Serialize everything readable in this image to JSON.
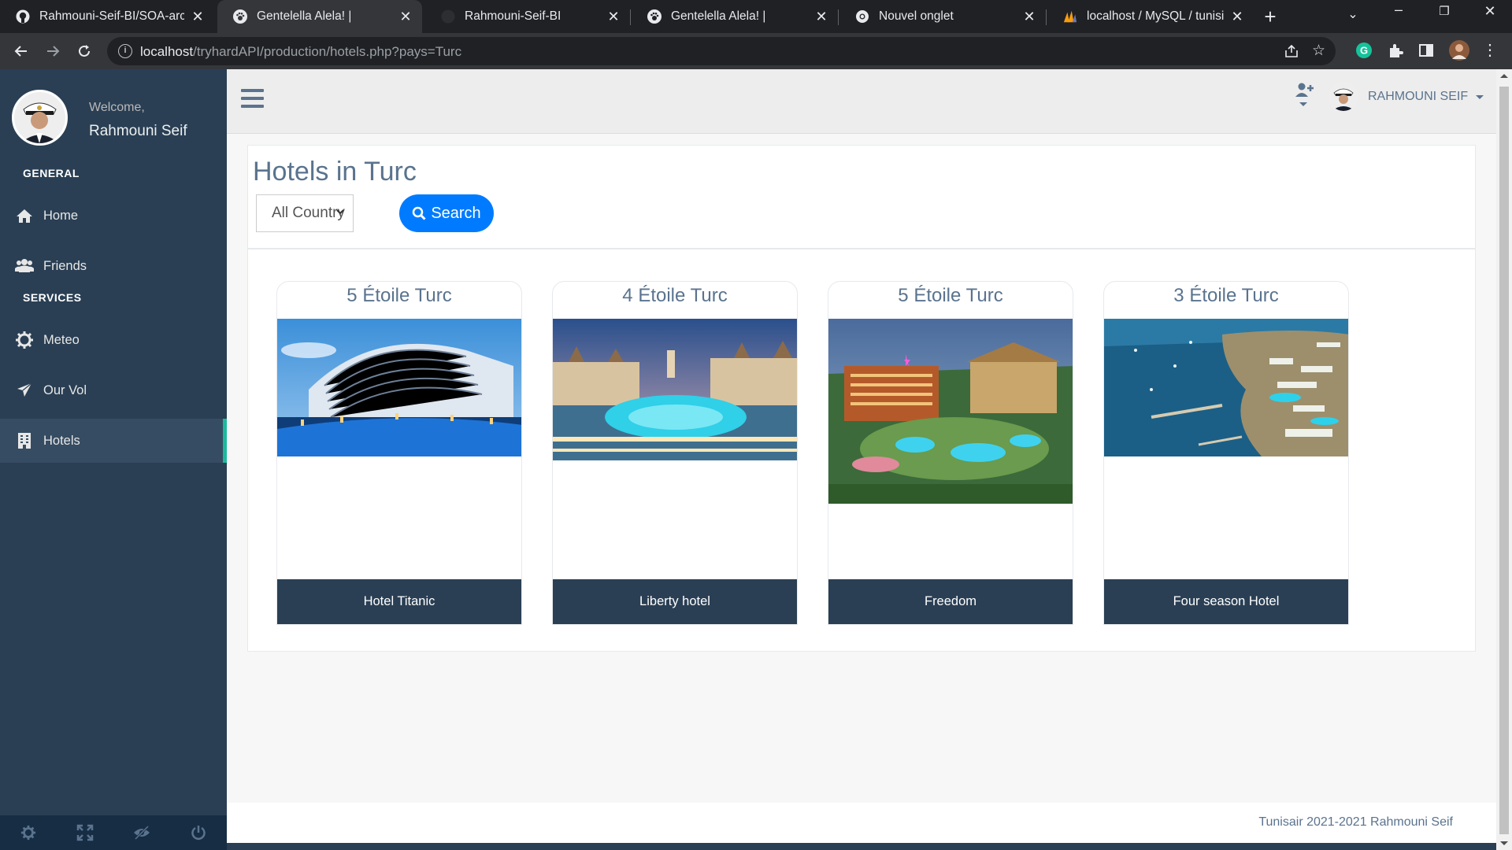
{
  "browser": {
    "tabs": [
      {
        "title": "Rahmouni-Seif-BI/SOA-arc",
        "icon": "github-icon",
        "active": false
      },
      {
        "title": "Gentelella Alela! |",
        "icon": "paw-icon",
        "active": true
      },
      {
        "title": "Rahmouni-Seif-BI",
        "icon": "github-icon",
        "active": false
      },
      {
        "title": "Gentelella Alela! |",
        "icon": "paw-icon",
        "active": false
      },
      {
        "title": "Nouvel onglet",
        "icon": "chrome-icon",
        "active": false
      },
      {
        "title": "localhost / MySQL / tunisia",
        "icon": "phpmyadmin-icon",
        "active": false
      }
    ],
    "url_host": "localhost",
    "url_path": "/tryhardAPI/production/hotels.php?pays=Turc"
  },
  "sidebar": {
    "welcome": "Welcome,",
    "username": "Rahmouni Seif",
    "sections": {
      "general": "GENERAL",
      "services": "SERVICES"
    },
    "items": [
      {
        "label": "Home",
        "icon": "home-icon"
      },
      {
        "label": "Friends",
        "icon": "users-icon"
      },
      {
        "label": "Meteo",
        "icon": "gear-icon"
      },
      {
        "label": "Our Vol",
        "icon": "plane-icon"
      },
      {
        "label": "Hotels",
        "icon": "building-icon",
        "active": true
      }
    ],
    "footer_icons": [
      "settings-icon",
      "fullscreen-icon",
      "hide-icon",
      "power-icon"
    ]
  },
  "topnav": {
    "profile_name": "RAHMOUNI SEIF"
  },
  "page": {
    "title": "Hotels in Turc",
    "select_value": "All Country",
    "search_label": "Search"
  },
  "hotels": [
    {
      "stars": "5 Étoile Turc",
      "name": "Hotel Titanic"
    },
    {
      "stars": "4 Étoile Turc",
      "name": "Liberty hotel"
    },
    {
      "stars": "5 Étoile Turc",
      "name": "Freedom"
    },
    {
      "stars": "3 Étoile Turc",
      "name": "Four season Hotel"
    }
  ],
  "footer": {
    "text": "Tunisair 2021-2021 Rahmouni Seif"
  },
  "colors": {
    "sidebar": "#2a3f54",
    "accent": "#1abb9c",
    "primary": "#007bff",
    "heading": "#5a738e"
  }
}
